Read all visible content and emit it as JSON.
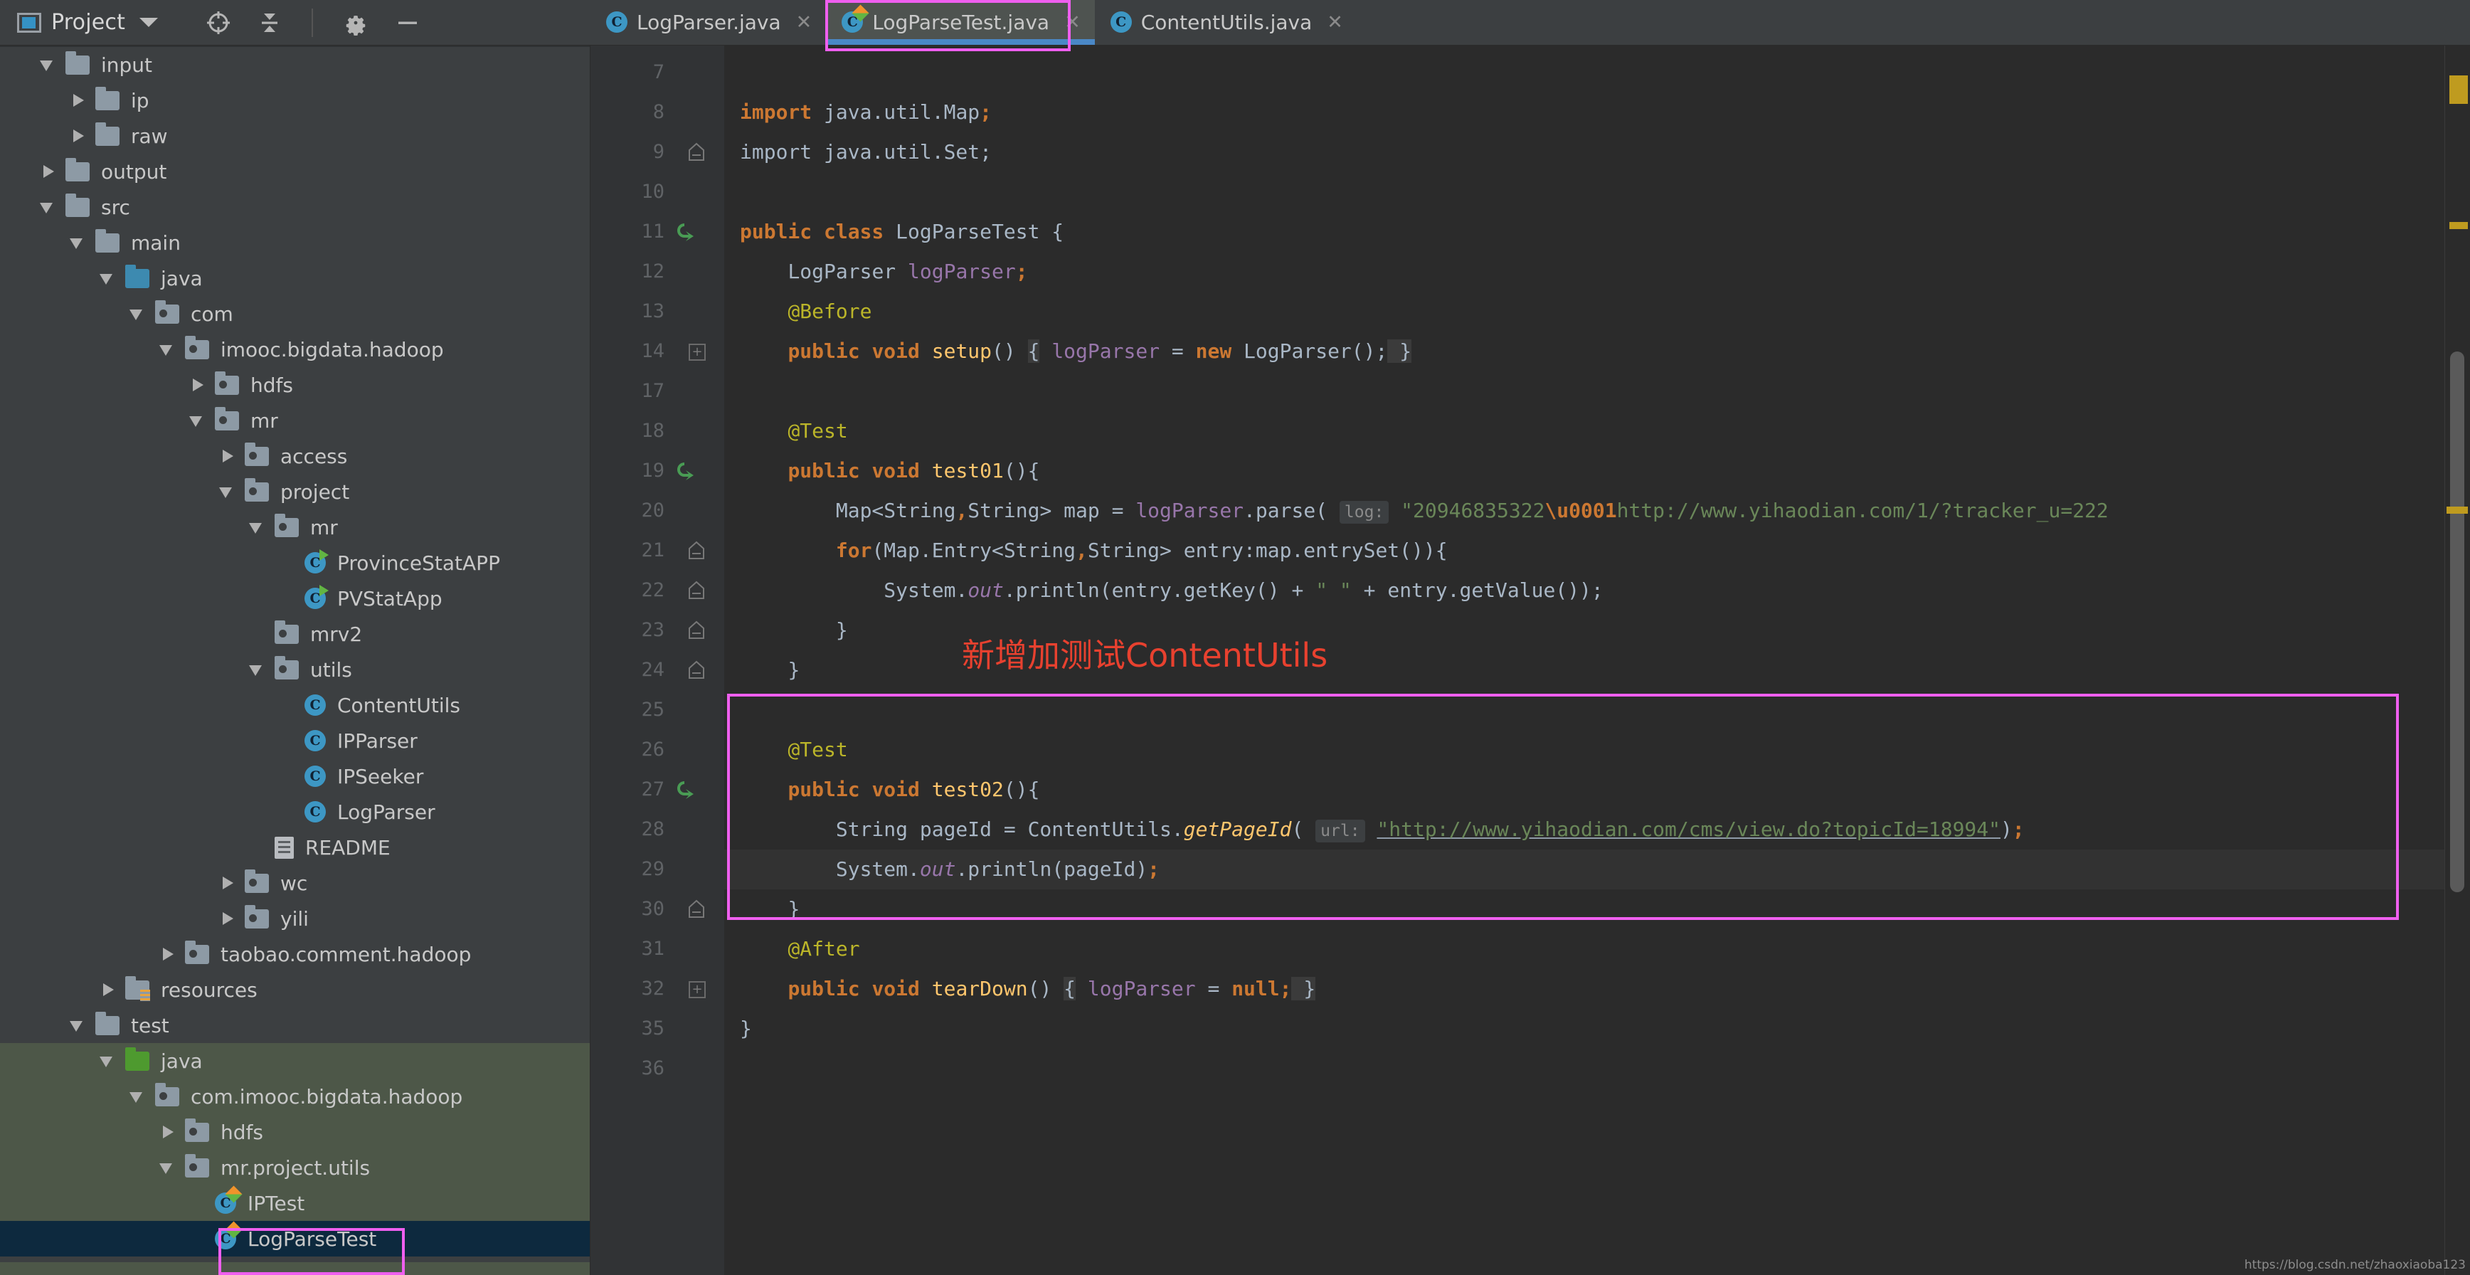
{
  "window": {
    "project_button_label": "Project",
    "toolbar_icons": [
      "locate-target-icon",
      "collapse-all-icon",
      "settings-gear-icon",
      "hide-icon"
    ]
  },
  "tabs": [
    {
      "label": "LogParser.java",
      "icon": "java-class-icon",
      "active": false,
      "close": "✕"
    },
    {
      "label": "LogParseTest.java",
      "icon": "java-test-class-icon",
      "active": true,
      "close": "✕"
    },
    {
      "label": "ContentUtils.java",
      "icon": "java-class-icon",
      "active": false,
      "close": "✕"
    }
  ],
  "tree": [
    {
      "label": "input",
      "indent": 1,
      "arrow": "down",
      "icon": "folder"
    },
    {
      "label": "ip",
      "indent": 2,
      "arrow": "right",
      "icon": "folder"
    },
    {
      "label": "raw",
      "indent": 2,
      "arrow": "right",
      "icon": "folder"
    },
    {
      "label": "output",
      "indent": 1,
      "arrow": "right",
      "icon": "folder"
    },
    {
      "label": "src",
      "indent": 1,
      "arrow": "down",
      "icon": "folder"
    },
    {
      "label": "main",
      "indent": 2,
      "arrow": "down",
      "icon": "folder"
    },
    {
      "label": "java",
      "indent": 3,
      "arrow": "down",
      "icon": "folder-source"
    },
    {
      "label": "com",
      "indent": 4,
      "arrow": "down",
      "icon": "folder-package"
    },
    {
      "label": "imooc.bigdata.hadoop",
      "indent": 5,
      "arrow": "down",
      "icon": "folder-package"
    },
    {
      "label": "hdfs",
      "indent": 6,
      "arrow": "right",
      "icon": "folder-package"
    },
    {
      "label": "mr",
      "indent": 6,
      "arrow": "down",
      "icon": "folder-package"
    },
    {
      "label": "access",
      "indent": 7,
      "arrow": "right",
      "icon": "folder-package"
    },
    {
      "label": "project",
      "indent": 7,
      "arrow": "down",
      "icon": "folder-package"
    },
    {
      "label": "mr",
      "indent": 8,
      "arrow": "down",
      "icon": "folder-package"
    },
    {
      "label": "ProvinceStatAPP",
      "indent": 9,
      "arrow": "none",
      "icon": "java-runnable-class-icon"
    },
    {
      "label": "PVStatApp",
      "indent": 9,
      "arrow": "none",
      "icon": "java-runnable-class-icon"
    },
    {
      "label": "mrv2",
      "indent": 8,
      "arrow": "none",
      "icon": "folder-package"
    },
    {
      "label": "utils",
      "indent": 8,
      "arrow": "down",
      "icon": "folder-package"
    },
    {
      "label": "ContentUtils",
      "indent": 9,
      "arrow": "none",
      "icon": "java-class-icon"
    },
    {
      "label": "IPParser",
      "indent": 9,
      "arrow": "none",
      "icon": "java-class-icon"
    },
    {
      "label": "IPSeeker",
      "indent": 9,
      "arrow": "none",
      "icon": "java-class-icon"
    },
    {
      "label": "LogParser",
      "indent": 9,
      "arrow": "none",
      "icon": "java-class-icon"
    },
    {
      "label": "README",
      "indent": 8,
      "arrow": "none",
      "icon": "file-icon"
    },
    {
      "label": "wc",
      "indent": 7,
      "arrow": "right",
      "icon": "folder-package"
    },
    {
      "label": "yili",
      "indent": 7,
      "arrow": "right",
      "icon": "folder-package"
    },
    {
      "label": "taobao.comment.hadoop",
      "indent": 5,
      "arrow": "right",
      "icon": "folder-package"
    },
    {
      "label": "resources",
      "indent": 3,
      "arrow": "right",
      "icon": "folder-resources"
    },
    {
      "label": "test",
      "indent": 2,
      "arrow": "down",
      "icon": "folder"
    },
    {
      "label": "java",
      "indent": 3,
      "arrow": "down",
      "icon": "folder-test-source",
      "scope": "test"
    },
    {
      "label": "com.imooc.bigdata.hadoop",
      "indent": 4,
      "arrow": "down",
      "icon": "folder-package",
      "scope": "test"
    },
    {
      "label": "hdfs",
      "indent": 5,
      "arrow": "right",
      "icon": "folder-package",
      "scope": "test"
    },
    {
      "label": "mr.project.utils",
      "indent": 5,
      "arrow": "down",
      "icon": "folder-package",
      "scope": "test"
    },
    {
      "label": "IPTest",
      "indent": 6,
      "arrow": "none",
      "icon": "java-test-class-icon",
      "scope": "test"
    },
    {
      "label": "LogParseTest",
      "indent": 6,
      "arrow": "none",
      "icon": "java-test-class-icon",
      "scope": "test",
      "selected": true
    }
  ],
  "editor": {
    "line_numbers": [
      "7",
      "8",
      "9",
      "10",
      "11",
      "12",
      "13",
      "14",
      "17",
      "18",
      "19",
      "20",
      "21",
      "22",
      "23",
      "24",
      "25",
      "26",
      "27",
      "28",
      "29",
      "30",
      "31",
      "32",
      "35",
      "36"
    ],
    "lines": [
      "",
      "import java.util.Map;",
      "import java.util.Set;",
      "",
      "public class LogParseTest {",
      "    LogParser logParser;",
      "    @Before",
      "    public void setup() { logParser = new LogParser(); }",
      "",
      "    @Test",
      "    public void test01(){",
      "        Map<String,String> map = logParser.parse( log: \"20946835322\\u0001http://www.yihaodian.com/1/?tracker_u=222",
      "        for(Map.Entry<String,String> entry:map.entrySet()){",
      "            System.out.println(entry.getKey() + \" \" + entry.getValue());",
      "        }",
      "    }",
      "",
      "    @Test",
      "    public void test02(){",
      "        String pageId = ContentUtils.getPageId( url: \"http://www.yihaodian.com/cms/view.do?topicId=18994\");",
      "        System.out.println(pageId);",
      "    }",
      "    @After",
      "    public void tearDown() { logParser = null; }",
      "}",
      ""
    ],
    "parameter_hints": [
      "log:",
      "url:"
    ],
    "string_literals": [
      "\"20946835322\\u0001http://www.yihaodian.com/1/?tracker_u=222",
      "\"http://www.yihaodian.com/cms/view.do?topicId=18994\""
    ]
  },
  "annotations": {
    "note_text": "新增加测试ContentUtils",
    "note_color": "#e8412f",
    "box_color": "#ef5fef",
    "boxes": [
      "tab-highlight-box",
      "test02-method-box",
      "tree-logparsetest-box"
    ]
  },
  "watermark": "https://blog.csdn.net/zhaoxiaoba123",
  "colors": {
    "editor_bg": "#2b2b2b",
    "panel_bg": "#3c3f41",
    "gutter_bg": "#313335",
    "selection_bg": "#0d293e",
    "test_scope_bg": "#4d5748",
    "keyword": "#cc7832",
    "annotation": "#bbb529",
    "method": "#ffc66d",
    "field": "#9876aa",
    "string": "#6a8759",
    "text": "#a9b7c6",
    "tab_underline": "#4a88c7",
    "warning_marker": "#bf9b1f"
  }
}
